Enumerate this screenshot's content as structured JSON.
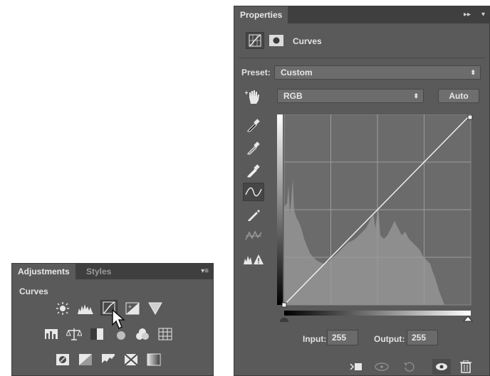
{
  "adjustments_panel": {
    "tabs": [
      "Adjustments",
      "Styles"
    ],
    "section_title": "Curves",
    "icons_row1": [
      "brightness-contrast-icon",
      "levels-icon",
      "curves-icon",
      "exposure-icon",
      "gradient-triangle-icon"
    ],
    "icons_row2": [
      "vibrance-icon",
      "color-balance-icon",
      "black-white-icon",
      "photo-filter-icon",
      "channel-mixer-icon",
      "color-lookup-icon"
    ],
    "icons_row3": [
      "invert-icon",
      "posterize-icon",
      "threshold-icon",
      "selective-color-icon",
      "gradient-map-icon"
    ]
  },
  "properties_panel": {
    "tab": "Properties",
    "title": "Curves",
    "preset_label": "Preset:",
    "preset_value": "Custom",
    "channel_value": "RGB",
    "auto_label": "Auto",
    "input_label": "Input:",
    "input_value": "255",
    "output_label": "Output:",
    "output_value": "255"
  },
  "colors": {
    "panel_bg": "#5a5a5a",
    "graph_bg": "#6b6b6b",
    "histogram": "#8c8c8c"
  }
}
